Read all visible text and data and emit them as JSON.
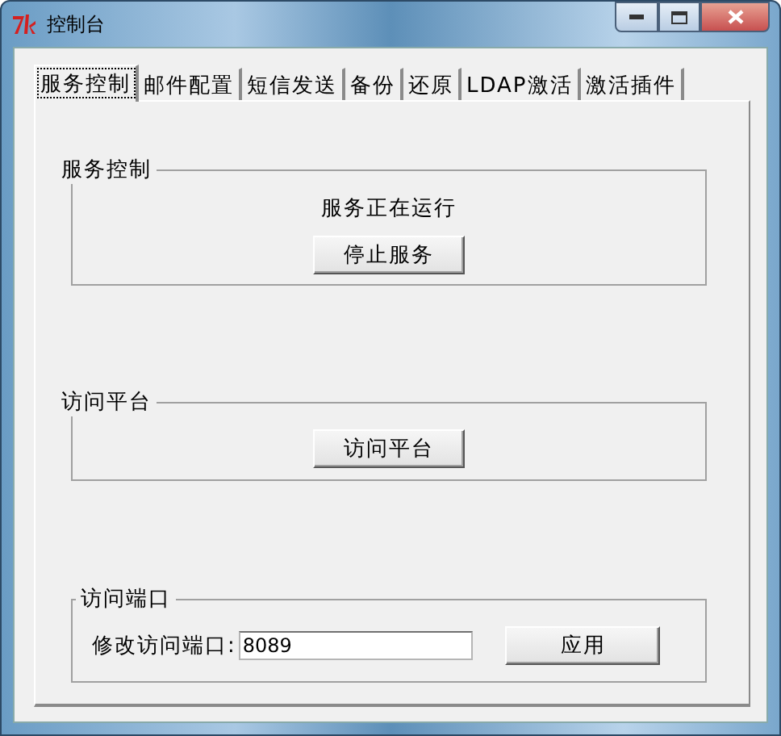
{
  "window": {
    "title": "控制台"
  },
  "tabs": [
    {
      "label": "服务控制",
      "selected": true
    },
    {
      "label": "邮件配置",
      "selected": false
    },
    {
      "label": "短信发送",
      "selected": false
    },
    {
      "label": "备份",
      "selected": false
    },
    {
      "label": "还原",
      "selected": false
    },
    {
      "label": "LDAP激活",
      "selected": false
    },
    {
      "label": "激活插件",
      "selected": false
    }
  ],
  "groups": [
    {
      "kind": "status",
      "title": "服务控制",
      "status": "服务正在运行",
      "button": "停止服务"
    },
    {
      "kind": "action",
      "title": "访问平台",
      "button": "访问平台"
    },
    {
      "kind": "port",
      "title": "访问端口",
      "label": "修改访问端口:",
      "value": "8089",
      "button": "应用"
    }
  ]
}
